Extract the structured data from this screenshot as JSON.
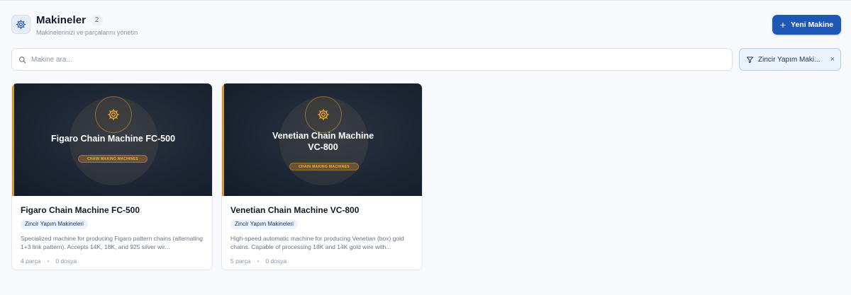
{
  "header": {
    "title": "Makineler",
    "count": "2",
    "subtitle": "Makinelerinizi ve parçalarını yönetin",
    "new_button_label": "Yeni Makine"
  },
  "search": {
    "placeholder": "Makine ara...",
    "value": ""
  },
  "filter": {
    "label": "Zincir Yapım Maki...",
    "close_symbol": "×"
  },
  "colors": {
    "accent": "#1f57b7",
    "card_media_border": "#d9962a",
    "media_pill_text": "#f0b245"
  },
  "cards": [
    {
      "media_title": "Figaro Chain Machine FC-500",
      "media_tag": "CHAIN MAKING MACHINES",
      "title": "Figaro Chain Machine FC-500",
      "category": "Zincir Yapım Makineleri",
      "description": "Specialized machine for producing Figaro pattern chains (alternating 1+3 link pattern). Accepts 14K, 18K, and 925 silver wir...",
      "parts": "4 parça",
      "files": "0 dosya"
    },
    {
      "media_title_line1": "Venetian Chain Machine",
      "media_title_line2": "VC-800",
      "media_tag": "CHAIN MAKING MACHINES",
      "title": "Venetian Chain Machine VC-800",
      "category": "Zincir Yapım Makineleri",
      "description": "High-speed automatic machine for producing Venetian (box) gold chains. Capable of processing 18K and 14K gold wire with...",
      "parts": "5 parça",
      "files": "0 dosya"
    }
  ]
}
